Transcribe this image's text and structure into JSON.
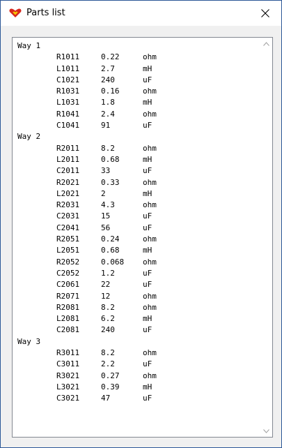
{
  "window": {
    "title": "Parts list",
    "icon": "red-heart-app-icon",
    "close_icon": "close-icon"
  },
  "groups": [
    {
      "name": "Way 1",
      "parts": [
        {
          "id": "R1011",
          "value": "0.22",
          "unit": "ohm"
        },
        {
          "id": "L1011",
          "value": "2.7",
          "unit": "mH"
        },
        {
          "id": "C1021",
          "value": "240",
          "unit": "uF"
        },
        {
          "id": "R1031",
          "value": "0.16",
          "unit": "ohm"
        },
        {
          "id": "L1031",
          "value": "1.8",
          "unit": "mH"
        },
        {
          "id": "R1041",
          "value": "2.4",
          "unit": "ohm"
        },
        {
          "id": "C1041",
          "value": "91",
          "unit": "uF"
        }
      ]
    },
    {
      "name": "Way 2",
      "parts": [
        {
          "id": "R2011",
          "value": "8.2",
          "unit": "ohm"
        },
        {
          "id": "L2011",
          "value": "0.68",
          "unit": "mH"
        },
        {
          "id": "C2011",
          "value": "33",
          "unit": "uF"
        },
        {
          "id": "R2021",
          "value": "0.33",
          "unit": "ohm"
        },
        {
          "id": "L2021",
          "value": "2",
          "unit": "mH"
        },
        {
          "id": "R2031",
          "value": "4.3",
          "unit": "ohm"
        },
        {
          "id": "C2031",
          "value": "15",
          "unit": "uF"
        },
        {
          "id": "C2041",
          "value": "56",
          "unit": "uF"
        },
        {
          "id": "R2051",
          "value": "0.24",
          "unit": "ohm"
        },
        {
          "id": "L2051",
          "value": "0.68",
          "unit": "mH"
        },
        {
          "id": "R2052",
          "value": "0.068",
          "unit": "ohm"
        },
        {
          "id": "C2052",
          "value": "1.2",
          "unit": "uF"
        },
        {
          "id": "C2061",
          "value": "22",
          "unit": "uF"
        },
        {
          "id": "R2071",
          "value": "12",
          "unit": "ohm"
        },
        {
          "id": "R2081",
          "value": "8.2",
          "unit": "ohm"
        },
        {
          "id": "L2081",
          "value": "6.2",
          "unit": "mH"
        },
        {
          "id": "C2081",
          "value": "240",
          "unit": "uF"
        }
      ]
    },
    {
      "name": "Way 3",
      "parts": [
        {
          "id": "R3011",
          "value": "8.2",
          "unit": "ohm"
        },
        {
          "id": "C3011",
          "value": "2.2",
          "unit": "uF"
        },
        {
          "id": "R3021",
          "value": "0.27",
          "unit": "ohm"
        },
        {
          "id": "L3021",
          "value": "0.39",
          "unit": "mH"
        },
        {
          "id": "C3021",
          "value": "47",
          "unit": "uF"
        }
      ]
    }
  ],
  "scrollbar": {
    "up_icon": "chevron-up-icon",
    "down_icon": "chevron-down-icon"
  },
  "colors": {
    "window_border": "#2b5797",
    "list_border": "#828790",
    "icon_red": "#d7261c",
    "icon_yellow": "#f5c400"
  }
}
